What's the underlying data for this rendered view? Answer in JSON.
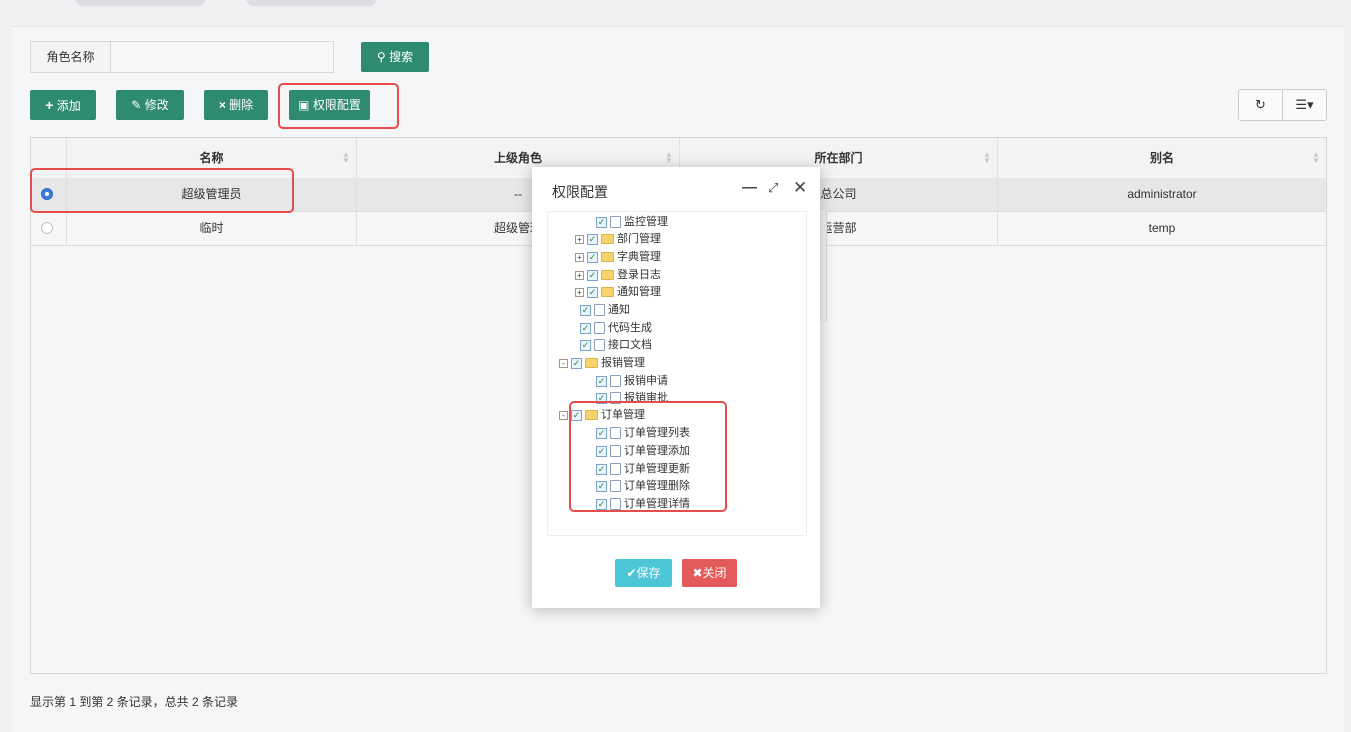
{
  "search": {
    "label": "角色名称",
    "input_value": "",
    "button": "搜索"
  },
  "toolbar": {
    "add": "添加",
    "edit": "修改",
    "delete": "删除",
    "permission": "权限配置"
  },
  "table": {
    "columns": [
      "名称",
      "上级角色",
      "所在部门",
      "别名"
    ],
    "rows": [
      {
        "selected": true,
        "name": "超级管理员",
        "parent": "--",
        "dept": "总公司",
        "alias": "administrator"
      },
      {
        "selected": false,
        "name": "临时",
        "parent": "超级管理",
        "dept": "运营部",
        "alias": "temp"
      }
    ]
  },
  "footer": "显示第 1 到第 2 条记录，总共 2 条记录",
  "modal": {
    "title": "权限配置",
    "save": "✔保存",
    "close": "✖关闭",
    "tree": [
      {
        "label": "监控管理",
        "type": "file",
        "expander": ""
      },
      {
        "label": "部门管理",
        "type": "folder",
        "expander": "+"
      },
      {
        "label": "字典管理",
        "type": "folder",
        "expander": "+"
      },
      {
        "label": "登录日志",
        "type": "folder",
        "expander": "+"
      },
      {
        "label": "通知管理",
        "type": "folder",
        "expander": "+"
      },
      {
        "label": "通知",
        "type": "file",
        "expander": ""
      },
      {
        "label": "代码生成",
        "type": "file",
        "expander": ""
      },
      {
        "label": "接口文档",
        "type": "file",
        "expander": ""
      },
      {
        "label": "报销管理",
        "type": "folder",
        "expander": "-"
      },
      {
        "label": "报销申请",
        "type": "file",
        "expander": ""
      },
      {
        "label": "报销审批",
        "type": "file",
        "expander": ""
      },
      {
        "label": "订单管理",
        "type": "folder",
        "expander": "-"
      },
      {
        "label": "订单管理列表",
        "type": "file",
        "expander": ""
      },
      {
        "label": "订单管理添加",
        "type": "file",
        "expander": ""
      },
      {
        "label": "订单管理更新",
        "type": "file",
        "expander": ""
      },
      {
        "label": "订单管理删除",
        "type": "file",
        "expander": ""
      },
      {
        "label": "订单管理详情",
        "type": "file",
        "expander": ""
      }
    ]
  },
  "colors": {
    "primary_green": "#2e8b6f",
    "highlight_red": "#e74c4c",
    "save_cyan": "#4dc6d6",
    "close_red": "#e25a5a"
  }
}
